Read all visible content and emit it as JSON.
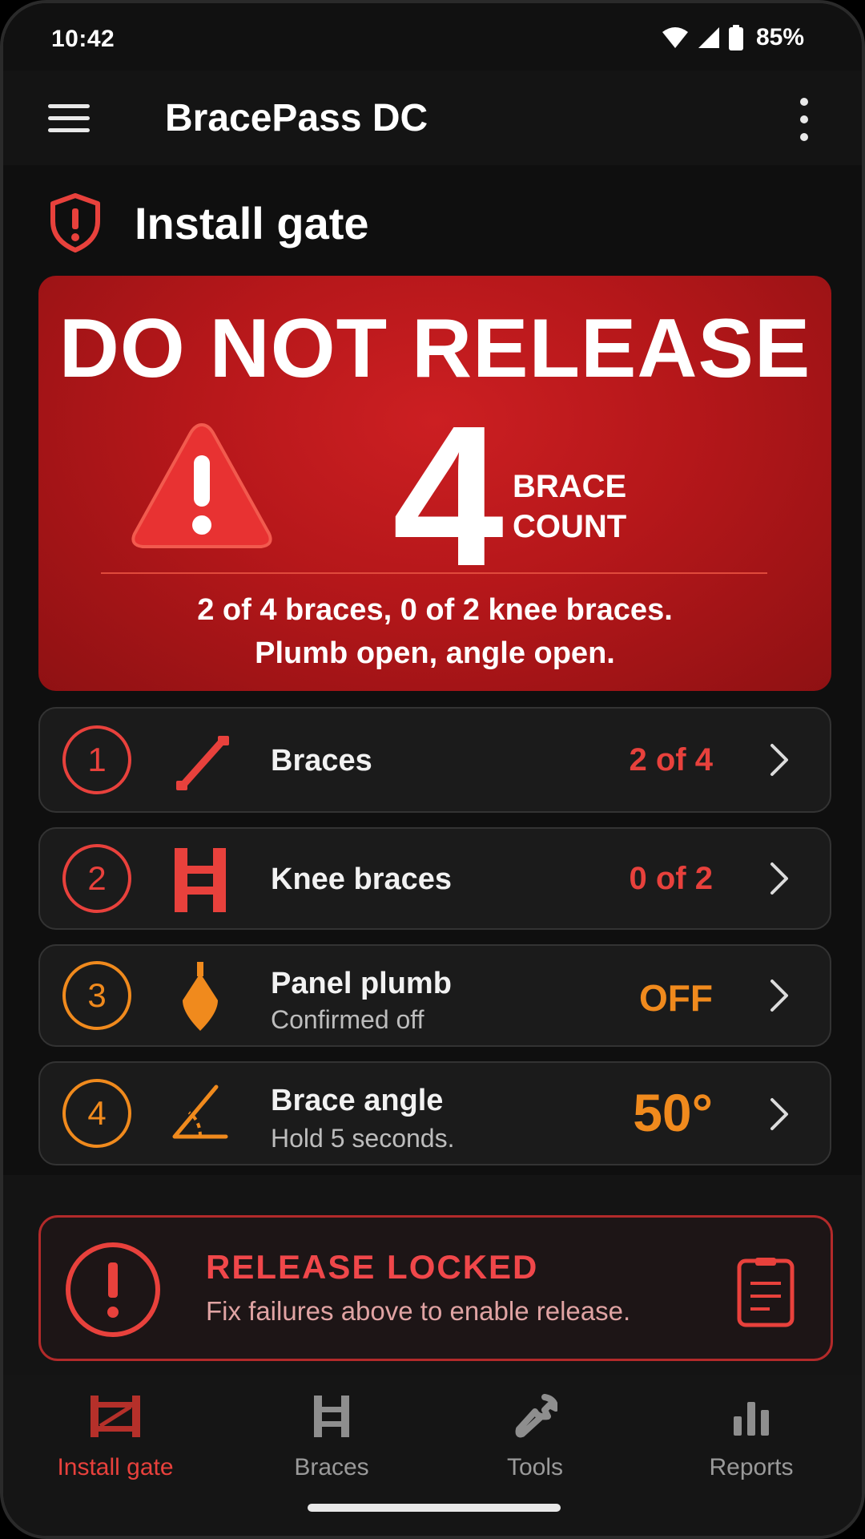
{
  "status_bar": {
    "time": "10:42",
    "battery": "85%"
  },
  "app_bar": {
    "title": "BracePass DC"
  },
  "page": {
    "title": "Install gate"
  },
  "alert": {
    "headline": "DO NOT RELEASE",
    "count": "4",
    "count_label_line1": "BRACE",
    "count_label_line2": "COUNT",
    "summary_line1": "2 of 4 braces, 0 of 2 knee braces.",
    "summary_line2": "Plumb open, angle open."
  },
  "checks": [
    {
      "step": "1",
      "title": "Braces",
      "subtitle": "",
      "value": "2 of 4",
      "status": "fail",
      "icon": "brace-icon"
    },
    {
      "step": "2",
      "title": "Knee braces",
      "subtitle": "",
      "value": "0 of 2",
      "status": "fail",
      "icon": "knee-brace-icon"
    },
    {
      "step": "3",
      "title": "Panel plumb",
      "subtitle": "Confirmed off",
      "value": "OFF",
      "status": "warn",
      "icon": "plumb-bob-icon"
    },
    {
      "step": "4",
      "title": "Brace angle",
      "subtitle": "Hold 5 seconds.",
      "value": "50°",
      "status": "warn",
      "icon": "angle-icon"
    }
  ],
  "lock_banner": {
    "title": "RELEASE LOCKED",
    "subtitle": "Fix failures above to enable release."
  },
  "bottom_nav": [
    {
      "label": "Install gate",
      "active": true,
      "icon": "install-gate-icon"
    },
    {
      "label": "Braces",
      "active": false,
      "icon": "braces-icon"
    },
    {
      "label": "Tools",
      "active": false,
      "icon": "wrench-icon"
    },
    {
      "label": "Reports",
      "active": false,
      "icon": "bar-chart-icon"
    }
  ],
  "colors": {
    "fail": "#e8413c",
    "warn": "#f08a1d",
    "alert_bg": "#b5171a",
    "background": "#0f0f0f"
  }
}
